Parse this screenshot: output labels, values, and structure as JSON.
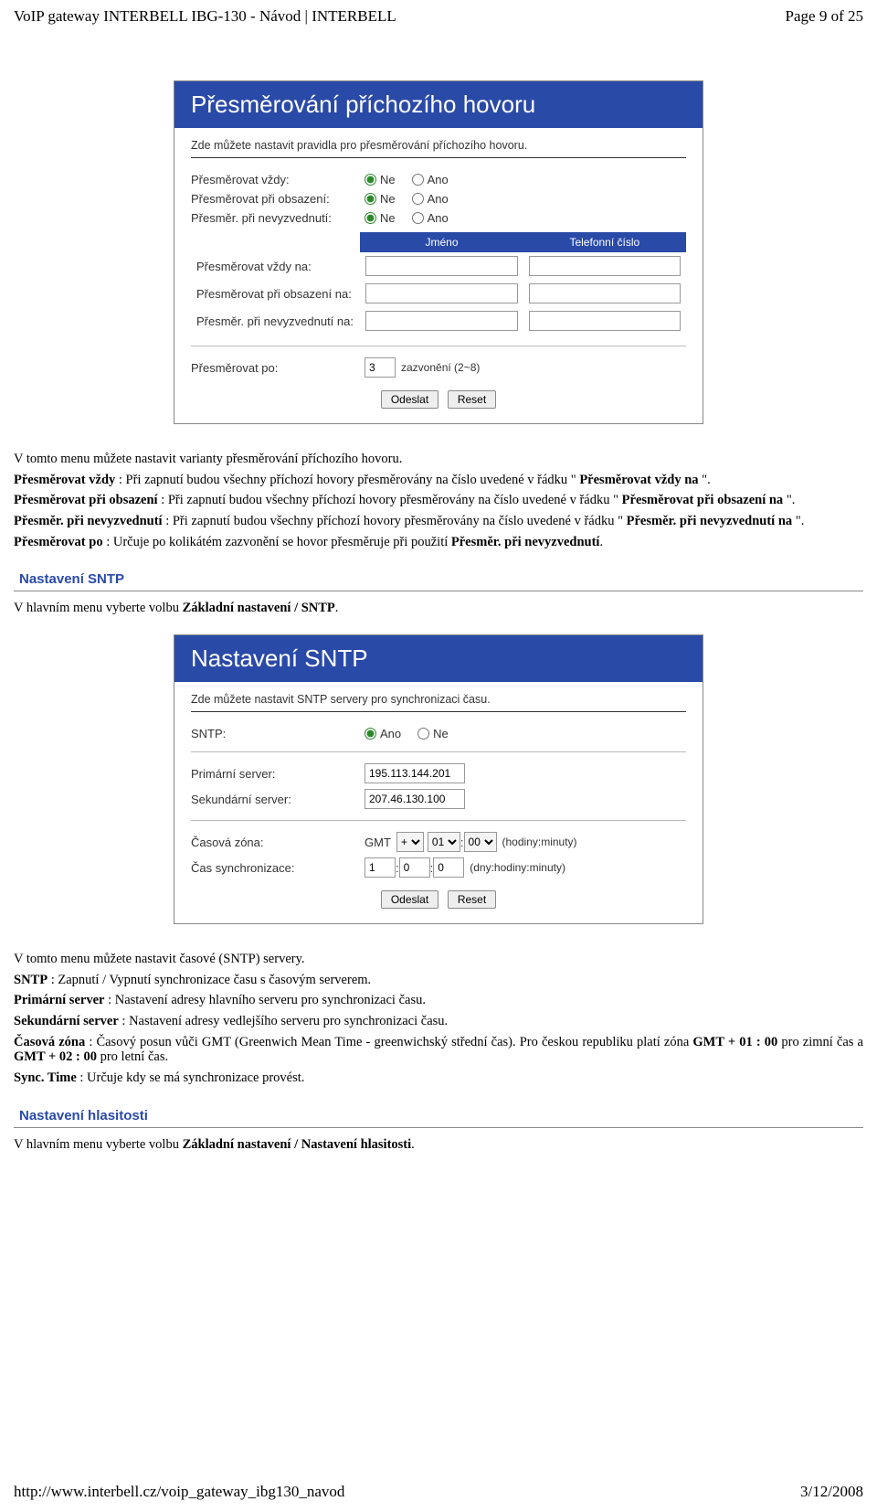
{
  "header": {
    "left": "VoIP gateway INTERBELL IBG-130 - Návod | INTERBELL",
    "right": "Page 9 of 25"
  },
  "panel1": {
    "title": "Přesměrování příchozího hovoru",
    "desc": "Zde můžete nastavit pravidla pro přesměrování příchozího hovoru.",
    "rows": [
      {
        "label": "Přesměrovat vždy:",
        "ne": "Ne",
        "ano": "Ano"
      },
      {
        "label": "Přesměrovat při obsazení:",
        "ne": "Ne",
        "ano": "Ano"
      },
      {
        "label": "Přesměr. při nevyzvednutí:",
        "ne": "Ne",
        "ano": "Ano"
      }
    ],
    "th_name": "Jméno",
    "th_tel": "Telefonní číslo",
    "trows": [
      "Přesměrovat vždy na:",
      "Přesměrovat při obsazení na:",
      "Přesměr. při nevyzvednutí na:"
    ],
    "after_label": "Přesměrovat po:",
    "after_value": "3",
    "after_hint": "zazvonění (2~8)",
    "btn_submit": "Odeslat",
    "btn_reset": "Reset"
  },
  "text1": {
    "p0": "V tomto menu můžete nastavit varianty přesměrování příchozího hovoru.",
    "p1a": "Přesměrovat vždy",
    "p1b": " : Při zapnutí budou všechny příchozí hovory přesměrovány na číslo uvedené v řádku \" ",
    "p1c": "Přesměrovat vždy na",
    "p1d": " \".",
    "p2a": "Přesměrovat při obsazení",
    "p2b": " : Při zapnutí budou všechny příchozí hovory přesměrovány na číslo uvedené v řádku \" ",
    "p2c": "Přesměrovat při obsazení na",
    "p2d": " \".",
    "p3a": "Přesměr. při nevyzvednutí",
    "p3b": " : Při zapnutí budou všechny příchozí hovory přesměrovány na číslo uvedené v řádku \" ",
    "p3c": "Přesměr. při nevyzvednutí na",
    "p3d": " \".",
    "p4a": "Přesměrovat po",
    "p4b": " : Určuje po kolikátém zazvonění se hovor přesměruje při použití ",
    "p4c": "Přesměr. při nevyzvednutí",
    "p4d": "."
  },
  "section_sntp": {
    "title": "Nastavení SNTP",
    "lead": "V hlavním menu vyberte volbu ",
    "lead_b": "Základní nastavení / SNTP",
    "lead_end": "."
  },
  "panel2": {
    "title": "Nastavení SNTP",
    "desc": "Zde můžete nastavit SNTP servery pro synchronizaci času.",
    "sntp_label": "SNTP:",
    "ano": "Ano",
    "ne": "Ne",
    "prim_label": "Primární server:",
    "prim_value": "195.113.144.201",
    "sec_label": "Sekundární server:",
    "sec_value": "207.46.130.100",
    "tz_label": "Časová zóna:",
    "tz_gmt": "GMT",
    "tz_sign": "+",
    "tz_h": "01",
    "tz_m": "00",
    "tz_hint": "(hodiny:minuty)",
    "sync_label": "Čas synchronizace:",
    "sync_d": "1",
    "sync_h": "0",
    "sync_m": "0",
    "sync_hint": "(dny:hodiny:minuty)",
    "btn_submit": "Odeslat",
    "btn_reset": "Reset"
  },
  "text2": {
    "p0": "V tomto menu můžete nastavit časové (SNTP) servery.",
    "l1a": "SNTP",
    "l1b": " : Zapnutí / Vypnutí synchronizace času s časovým serverem.",
    "l2a": "Primární server",
    "l2b": " : Nastavení adresy hlavního serveru pro synchronizaci času.",
    "l3a": "Sekundární server",
    "l3b": " : Nastavení adresy vedlejšího serveru pro synchronizaci času.",
    "l4a": "Časová zóna",
    "l4b": " : Časový posun vůči GMT (Greenwich Mean Time - greenwichský střední čas). Pro českou republiku platí zóna ",
    "l4c": "GMT + 01 : 00",
    "l4d": " pro zimní čas a ",
    "l4e": "GMT + 02 : 00",
    "l4f": " pro letní čas.",
    "l5a": "Sync. Time",
    "l5b": " : Určuje kdy se má synchronizace provést."
  },
  "section_vol": {
    "title": "Nastavení hlasitosti",
    "lead": "V hlavním menu vyberte volbu ",
    "lead_b": "Základní nastavení / Nastavení hlasitosti",
    "lead_end": "."
  },
  "footer": {
    "url": "http://www.interbell.cz/voip_gateway_ibg130_navod",
    "date": "3/12/2008"
  }
}
